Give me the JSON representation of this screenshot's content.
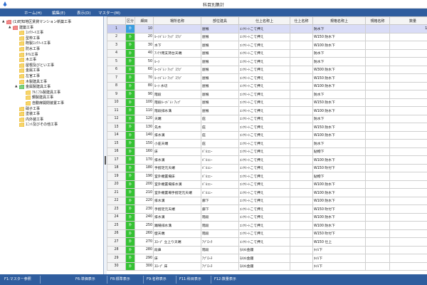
{
  "window": {
    "title": "科目別集計"
  },
  "menu": [
    {
      "label": "ホーム(H)"
    },
    {
      "label": "編集(E)"
    },
    {
      "label": "表示(D)"
    },
    {
      "label": "マスター(M)"
    }
  ],
  "tree": [
    {
      "label": "(1)町知地区賃貸マンション新築工事",
      "level": 0,
      "expander": "▲",
      "color": "red"
    },
    {
      "label": "建築工事",
      "level": 1,
      "expander": "▲",
      "color": "red"
    },
    {
      "label": "ｺﾝｸﾘｰﾄ工事",
      "level": 2,
      "expander": "",
      "color": "yellow"
    },
    {
      "label": "型枠工事",
      "level": 2,
      "expander": "",
      "color": "yellow"
    },
    {
      "label": "既製ｺﾝｸﾘｰﾄ工事",
      "level": 2,
      "expander": "",
      "color": "yellow"
    },
    {
      "label": "防水工事",
      "level": 2,
      "expander": "",
      "color": "yellow"
    },
    {
      "label": "ﾀｲﾙ工事",
      "level": 2,
      "expander": "",
      "color": "yellow"
    },
    {
      "label": "木工事",
      "level": 2,
      "expander": "",
      "color": "yellow"
    },
    {
      "label": "屋根及びとい工事",
      "level": 2,
      "expander": "",
      "color": "yellow"
    },
    {
      "label": "金属工事",
      "level": 2,
      "expander": "",
      "color": "yellow"
    },
    {
      "label": "左官工事",
      "level": 2,
      "expander": "",
      "color": "yellow"
    },
    {
      "label": "木製建具工事",
      "level": 2,
      "expander": "",
      "color": "yellow"
    },
    {
      "label": "金属製建具工事",
      "level": 2,
      "expander": "▲",
      "color": "green"
    },
    {
      "label": "ｱﾙﾐﾆｳﾑ製建具工事",
      "level": 3,
      "expander": "",
      "color": "yellow"
    },
    {
      "label": "鋼製建具工事",
      "level": 3,
      "expander": "",
      "color": "yellow"
    },
    {
      "label": "自動扉開閉装置工事",
      "level": 3,
      "expander": "",
      "color": "yellow"
    },
    {
      "label": "硝子工事",
      "level": 2,
      "expander": "",
      "color": "yellow"
    },
    {
      "label": "塗装工事",
      "level": 2,
      "expander": "",
      "color": "yellow"
    },
    {
      "label": "内外装工事",
      "level": 2,
      "expander": "",
      "color": "yellow"
    },
    {
      "label": "ﾕﾆｯﾄ及びその他工事",
      "level": 2,
      "expander": "",
      "color": "yellow"
    }
  ],
  "grid": {
    "headers": [
      "",
      "区分",
      "細目",
      "場所名称",
      "部位建具",
      "仕上名称上",
      "仕上名称",
      "規格名称上",
      "規格名称",
      "数量"
    ],
    "rows": [
      {
        "no": "1",
        "kubun": "外",
        "saimoku": "10",
        "basho": "",
        "bui": "屋根",
        "shiage_ue": "ｺﾝｸﾘｰﾄこて押え",
        "shiage": "",
        "kikaku_ue": "防水下",
        "kikaku": "",
        "suryo": "124.0"
      },
      {
        "no": "2",
        "kubun": "外",
        "saimoku": "20",
        "basho": "ﾙｰﾌﾄﾞﾚﾝ ｱｯﾌﾟ ｽﾗﾌﾞ",
        "bui": "屋根",
        "shiage_ue": "ｺﾝｸﾘｰﾄこて押え",
        "shiage": "",
        "kikaku_ue": "W150 防水下",
        "kikaku": "",
        "suryo": "44.5"
      },
      {
        "no": "3",
        "kubun": "外",
        "saimoku": "30",
        "basho": "水下",
        "bui": "屋根",
        "shiage_ue": "ｺﾝｸﾘｰﾄこて押え",
        "shiage": "",
        "kikaku_ue": "W100 防水下",
        "kikaku": "",
        "suryo": "6.5"
      },
      {
        "no": "4",
        "kubun": "外",
        "saimoku": "40",
        "basho": "ｱﾝﾃﾅ用支持台天端",
        "bui": "屋根",
        "shiage_ue": "ｺﾝｸﾘｰﾄこて押え",
        "shiage": "",
        "kikaku_ue": "防水下",
        "kikaku": "",
        "suryo": "0.3"
      },
      {
        "no": "5",
        "kubun": "外",
        "saimoku": "50",
        "basho": "ﾙｰﾌ",
        "bui": "屋根",
        "shiage_ue": "ｺﾝｸﾘｰﾄこて押え",
        "shiage": "",
        "kikaku_ue": "防水下",
        "kikaku": "",
        "suryo": "23.4"
      },
      {
        "no": "6",
        "kubun": "外",
        "saimoku": "60",
        "basho": "ﾙｰﾌﾄﾞﾚﾝ ｱｯﾌﾟ ｽﾗﾌﾞ",
        "bui": "屋根",
        "shiage_ue": "ｺﾝｸﾘｰﾄこて押え",
        "shiage": "",
        "kikaku_ue": "W300 防水下",
        "kikaku": "",
        "suryo": "6.9"
      },
      {
        "no": "7",
        "kubun": "外",
        "saimoku": "70",
        "basho": "ﾙｰﾌﾄﾞﾚﾝ ｱｯﾌﾟ ｽﾗﾌﾞ",
        "bui": "屋根",
        "shiage_ue": "ｺﾝｸﾘｰﾄこて押え",
        "shiage": "",
        "kikaku_ue": "W150 防水下",
        "kikaku": "",
        "suryo": "5.8"
      },
      {
        "no": "8",
        "kubun": "外",
        "saimoku": "80",
        "basho": "ﾙｰﾌ 水切",
        "bui": "屋根",
        "shiage_ue": "ｺﾝｸﾘｰﾄこて押え",
        "shiage": "",
        "kikaku_ue": "W100 防水下",
        "kikaku": "",
        "suryo": "5.2"
      },
      {
        "no": "9",
        "kubun": "外",
        "saimoku": "90",
        "basho": "階段",
        "bui": "屋根",
        "shiage_ue": "ｺﾝｸﾘｰﾄこて押え",
        "shiage": "",
        "kikaku_ue": "防水下",
        "kikaku": "",
        "suryo": "15.4"
      },
      {
        "no": "10",
        "kubun": "外",
        "saimoku": "100",
        "basho": "階段ﾙｰﾌﾄﾞﾚﾝ ｱｯﾌﾟ",
        "bui": "屋根",
        "shiage_ue": "ｺﾝｸﾘｰﾄこて押え",
        "shiage": "",
        "kikaku_ue": "W150 防水下",
        "kikaku": "",
        "suryo": "15.1"
      },
      {
        "no": "11",
        "kubun": "外",
        "saimoku": "110",
        "basho": "階段排水溝",
        "bui": "屋根",
        "shiage_ue": "ｺﾝｸﾘｰﾄこて押え",
        "shiage": "",
        "kikaku_ue": "W100 防水下",
        "kikaku": "",
        "suryo": "2.4"
      },
      {
        "no": "12",
        "kubun": "外",
        "saimoku": "120",
        "basho": "天端",
        "bui": "庇",
        "shiage_ue": "ｺﾝｸﾘｰﾄこて押え",
        "shiage": "",
        "kikaku_ue": "防水下",
        "kikaku": "",
        "suryo": "12.3"
      },
      {
        "no": "13",
        "kubun": "外",
        "saimoku": "130",
        "basho": "先木",
        "bui": "庇",
        "shiage_ue": "ｺﾝｸﾘｰﾄこて押え",
        "shiage": "",
        "kikaku_ue": "W150 防水下",
        "kikaku": "",
        "suryo": "12.5"
      },
      {
        "no": "14",
        "kubun": "外",
        "saimoku": "140",
        "basho": "排水溝",
        "bui": "庇",
        "shiage_ue": "ｺﾝｸﾘｰﾄこて押え",
        "shiage": "",
        "kikaku_ue": "W100 防水下",
        "kikaku": "",
        "suryo": "12.7"
      },
      {
        "no": "15",
        "kubun": "外",
        "saimoku": "150",
        "basho": "小庇天端",
        "bui": "庇",
        "shiage_ue": "ｺﾝｸﾘｰﾄこて押え",
        "shiage": "",
        "kikaku_ue": "防水下",
        "kikaku": "",
        "suryo": "0.1"
      },
      {
        "no": "16",
        "kubun": "外",
        "saimoku": "160",
        "basho": "床",
        "bui": "ﾊﾞﾙｺﾆｰ",
        "shiage_ue": "ｺﾝｸﾘｰﾄこて押え",
        "shiage": "",
        "kikaku_ue": "貼物下",
        "kikaku": "",
        "suryo": "37.6"
      },
      {
        "no": "17",
        "kubun": "外",
        "saimoku": "170",
        "basho": "排水溝",
        "bui": "ﾊﾞﾙｺﾆｰ",
        "shiage_ue": "ｺﾝｸﾘｰﾄこて押え",
        "shiage": "",
        "kikaku_ue": "W100 防水下",
        "kikaku": "",
        "suryo": "6.5"
      },
      {
        "no": "18",
        "kubun": "外",
        "saimoku": "180",
        "basho": "手摺足元天端",
        "bui": "ﾊﾞﾙｺﾆｰ",
        "shiage_ue": "ｺﾝｸﾘｰﾄこて押え",
        "shiage": "",
        "kikaku_ue": "W150 吹付下",
        "kikaku": "",
        "suryo": "9.6"
      },
      {
        "no": "19",
        "kubun": "外",
        "saimoku": "190",
        "basho": "室外機置場床",
        "bui": "ﾊﾞﾙｺﾆｰ",
        "shiage_ue": "ｺﾝｸﾘｰﾄこて押え",
        "shiage": "",
        "kikaku_ue": "貼物下",
        "kikaku": "",
        "suryo": "6.4"
      },
      {
        "no": "20",
        "kubun": "外",
        "saimoku": "200",
        "basho": "室外機置場排水溝",
        "bui": "ﾊﾞﾙｺﾆｰ",
        "shiage_ue": "ｺﾝｸﾘｰﾄこて押え",
        "shiage": "",
        "kikaku_ue": "W100 防水下",
        "kikaku": "",
        "suryo": "2.4"
      },
      {
        "no": "21",
        "kubun": "外",
        "saimoku": "210",
        "basho": "室外機置場手摺足元天端",
        "bui": "ﾊﾞﾙｺﾆｰ",
        "shiage_ue": "ｺﾝｸﾘｰﾄこて押え",
        "shiage": "",
        "kikaku_ue": "W100 防水下",
        "kikaku": "",
        "suryo": "0.9"
      },
      {
        "no": "22",
        "kubun": "外",
        "saimoku": "220",
        "basho": "排水溝",
        "bui": "廊下",
        "shiage_ue": "ｺﾝｸﾘｰﾄこて押え",
        "shiage": "",
        "kikaku_ue": "W100 防水下",
        "kikaku": "",
        "suryo": "5.1"
      },
      {
        "no": "23",
        "kubun": "外",
        "saimoku": "230",
        "basho": "手摺足元天端",
        "bui": "廊下",
        "shiage_ue": "ｺﾝｸﾘｰﾄこて押え",
        "shiage": "",
        "kikaku_ue": "W150 吹付下",
        "kikaku": "",
        "suryo": "8.0"
      },
      {
        "no": "24",
        "kubun": "外",
        "saimoku": "240",
        "basho": "排水溝",
        "bui": "階段",
        "shiage_ue": "ｺﾝｸﾘｰﾄこて押え",
        "shiage": "",
        "kikaku_ue": "W100 防水下",
        "kikaku": "",
        "suryo": "9.5"
      },
      {
        "no": "25",
        "kubun": "外",
        "saimoku": "250",
        "basho": "踊場排水溝",
        "bui": "階段",
        "shiage_ue": "ｺﾝｸﾘｰﾄこて押え",
        "shiage": "",
        "kikaku_ue": "W100 防水下",
        "kikaku": "",
        "suryo": "6.1"
      },
      {
        "no": "26",
        "kubun": "外",
        "saimoku": "260",
        "basho": "壁天端",
        "bui": "階段",
        "shiage_ue": "ｺﾝｸﾘｰﾄこて押え",
        "shiage": "",
        "kikaku_ue": "W150 吹付下",
        "kikaku": "",
        "suryo": "13.9"
      },
      {
        "no": "27",
        "kubun": "外",
        "saimoku": "270",
        "basho": "ｽﾛｰﾌﾟ 立上り天端",
        "bui": "ｱﾌﾟﾛｰﾁ",
        "shiage_ue": "ｺﾝｸﾘｰﾄこて押え",
        "shiage": "",
        "kikaku_ue": "W150 仕上",
        "kikaku": "",
        "suryo": "2.4"
      },
      {
        "no": "28",
        "kubun": "外",
        "saimoku": "280",
        "basho": "段鼻",
        "bui": "階段",
        "shiage_ue": "ﾓﾙﾀﾙ金鏝",
        "shiage": "",
        "kikaku_ue": "ﾀｲﾙ下",
        "kikaku": "",
        "suryo": "32.3"
      },
      {
        "no": "29",
        "kubun": "外",
        "saimoku": "290",
        "basho": "床",
        "bui": "ｱﾌﾟﾛｰﾁ",
        "shiage_ue": "ﾓﾙﾀﾙ金鏝",
        "shiage": "",
        "kikaku_ue": "ﾀｲﾙ下",
        "kikaku": "",
        "suryo": "17.1"
      },
      {
        "no": "30",
        "kubun": "外",
        "saimoku": "300",
        "basho": "ｽﾛｰﾌﾟ 床",
        "bui": "ｱﾌﾟﾛｰﾁ",
        "shiage_ue": "ﾓﾙﾀﾙ金鏝",
        "shiage": "",
        "kikaku_ue": "ﾀｲﾙ下",
        "kikaku": "",
        "suryo": "4.6"
      }
    ]
  },
  "status": [
    {
      "label": "F1:マスター参照"
    },
    {
      "label": "F6:単価表示"
    },
    {
      "label": "F8:標準表示"
    },
    {
      "label": "F9:名称表示"
    },
    {
      "label": "F11:科目表示"
    },
    {
      "label": "F12:数量表示"
    }
  ],
  "colors": {
    "menubar": "#2f5d9e",
    "kubun_green": "#35c233",
    "kubun_selected": "#3a9de0",
    "selected_row": "#d9dcf7"
  }
}
